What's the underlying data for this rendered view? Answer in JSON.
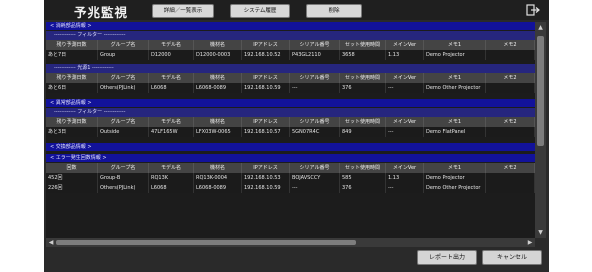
{
  "app": {
    "title": "予兆監視",
    "toolbar": [
      "詳細／一覧表示",
      "システム履歴",
      "削除"
    ]
  },
  "footer": {
    "report_label": "レポート出力",
    "cancel_label": "キャンセル"
  },
  "sections": [
    {
      "title": "< 消耗部品情報 >",
      "groups": [
        {
          "filter": "------------ フィルター ------------",
          "headers": [
            "残り予測日数",
            "グループ名",
            "モデル名",
            "機材名",
            "IPアドレス",
            "シリアル番号",
            "セット使用時間",
            "メインVer",
            "メモ1",
            "メモ2"
          ],
          "rows": [
            [
              "あと7日",
              "Group",
              "D12000",
              "D12000-0003",
              "192.168.10.52",
              "P43GL2110",
              "3658",
              "1.13",
              "Demo Projector",
              ""
            ]
          ]
        },
        {
          "filter": "------------ 光源1 ------------",
          "headers": [
            "残り予測日数",
            "グループ名",
            "モデル名",
            "機材名",
            "IPアドレス",
            "シリアル番号",
            "セット使用時間",
            "メインVer",
            "メモ1",
            "メモ2"
          ],
          "rows": [
            [
              "あと6日",
              "Others(PJLink)",
              "L6068",
              "L6068-0089",
              "192.168.10.59",
              "---",
              "376",
              "---",
              "Demo Other Projector",
              ""
            ]
          ]
        }
      ]
    },
    {
      "title": "< 異常部品情報 >",
      "groups": [
        {
          "filter": "------------ フィルター ------------",
          "headers": [
            "残り予測日数",
            "グループ名",
            "モデル名",
            "機材名",
            "IPアドレス",
            "シリアル番号",
            "セット使用時間",
            "メインVer",
            "メモ1",
            "メモ2"
          ],
          "rows": [
            [
              "あと3日",
              "Outside",
              "47LF165W",
              "LFX03W-0065",
              "192.168.10.57",
              "5GN07R4C",
              "849",
              "---",
              "Demo FlatPanel",
              ""
            ]
          ]
        }
      ]
    },
    {
      "title": "< 交換部品情報 >",
      "groups": []
    },
    {
      "title": "< エラー発生回数情報 >",
      "groups": [
        {
          "filter": "",
          "headers": [
            "回数",
            "グループ名",
            "モデル名",
            "機材名",
            "IPアドレス",
            "シリアル番号",
            "セット使用時間",
            "メインVer",
            "メモ1",
            "メモ2"
          ],
          "rows": [
            [
              "452回",
              "Group-B",
              "RQ13K",
              "RQ13K-0004",
              "192.168.10.53",
              "BOJAVSCCY",
              "585",
              "1.13",
              "Demo Projector",
              ""
            ],
            [
              "226回",
              "Others(PJLink)",
              "L6068",
              "L6068-0089",
              "192.168.10.59",
              "---",
              "376",
              "---",
              "Demo Other Projector",
              ""
            ]
          ]
        }
      ]
    }
  ]
}
